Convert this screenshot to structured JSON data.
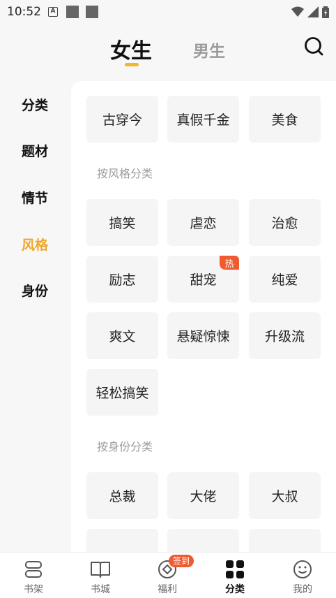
{
  "status": {
    "time": "10:52",
    "a_icon": "A"
  },
  "top_tabs": {
    "female": "女生",
    "male": "男生"
  },
  "left_nav": [
    "分类",
    "题材",
    "情节",
    "风格",
    "身份"
  ],
  "sections": {
    "top_row": [
      "古穿今",
      "真假千金",
      "美食"
    ],
    "style_title": "按风格分类",
    "style": [
      "搞笑",
      "虐恋",
      "治愈",
      "励志",
      "甜宠",
      "纯爱",
      "爽文",
      "悬疑惊悚",
      "升级流",
      "轻松搞笑"
    ],
    "hot_badge": "热",
    "identity_title": "按身份分类",
    "identity": [
      "总裁",
      "大佬",
      "大叔"
    ]
  },
  "bottom_nav": {
    "items": [
      "书架",
      "书城",
      "福利",
      "分类",
      "我的"
    ],
    "signin_badge": "签到"
  },
  "colors": {
    "accent": "#f0a62a",
    "indicator": "#f2b62d",
    "badge": "#ef5a2f"
  }
}
